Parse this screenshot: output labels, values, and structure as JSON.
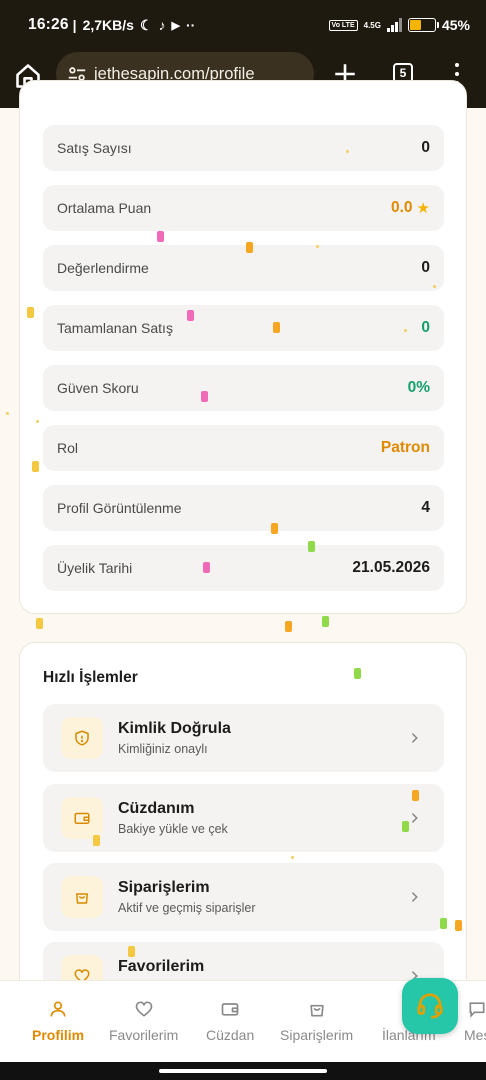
{
  "status_bar": {
    "time": "16:26",
    "speed": "2,7KB/s",
    "network_type": "4.5G",
    "volte": "Vo LTE",
    "battery": "45%",
    "battery_level": 0.45
  },
  "browser": {
    "url": "jethesapin.com/profile",
    "tab_count": "5"
  },
  "stats": [
    {
      "label": "Satış Sayısı",
      "value": "0"
    },
    {
      "label": "Ortalama Puan",
      "value": "0.0"
    },
    {
      "label": "Değerlendirme",
      "value": "0"
    },
    {
      "label": "Tamamlanan Satış",
      "value": "0"
    },
    {
      "label": "Güven Skoru",
      "value": "0%"
    },
    {
      "label": "Rol",
      "value": "Patron"
    },
    {
      "label": "Profil Görüntülenme",
      "value": "4"
    },
    {
      "label": "Üyelik Tarihi",
      "value": "21.05.2026"
    }
  ],
  "colors": {
    "accent": "#e08a00",
    "success": "#14a06a",
    "support_fab": "#26c7a8"
  },
  "quick_actions": {
    "title": "Hızlı İşlemler",
    "items": [
      {
        "title": "Kimlik Doğrula",
        "subtitle": "Kimliğiniz onaylı",
        "icon": "shield-icon"
      },
      {
        "title": "Cüzdanım",
        "subtitle": "Bakiye yükle ve çek",
        "icon": "wallet-icon"
      },
      {
        "title": "Siparişlerim",
        "subtitle": "Aktif ve geçmiş siparişler",
        "icon": "bag-icon"
      },
      {
        "title": "Favorilerim",
        "subtitle": "",
        "icon": "heart-icon"
      }
    ]
  },
  "bottom_nav": {
    "items": [
      {
        "label": "Profilim",
        "icon": "user-icon",
        "active": true
      },
      {
        "label": "Favorilerim",
        "icon": "heart-icon"
      },
      {
        "label": "Cüzdan",
        "icon": "wallet-icon"
      },
      {
        "label": "Siparişlerim",
        "icon": "bag-icon"
      },
      {
        "label": "İlanlarım",
        "icon": "list-icon"
      },
      {
        "label": "Mes",
        "icon": "message-icon"
      }
    ]
  }
}
